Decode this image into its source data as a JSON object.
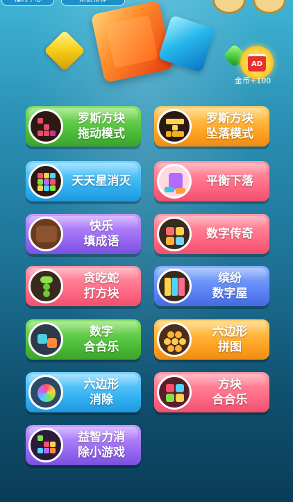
{
  "top": {
    "label_left": "福利中心",
    "label_middle": "新游推荐"
  },
  "ad": {
    "badge": "AD",
    "reward_text": "金币+100"
  },
  "games": [
    {
      "label": "罗斯方块\n拖动模式",
      "color": "green",
      "icon": "tetris-drag-icon"
    },
    {
      "label": "罗斯方块\n坠落模式",
      "color": "orange",
      "icon": "tetris-drop-icon"
    },
    {
      "label": "天天星消灭",
      "color": "blue",
      "icon": "star-crush-icon"
    },
    {
      "label": "平衡下落",
      "color": "pink",
      "icon": "balance-drop-icon"
    },
    {
      "label": "快乐\n填成语",
      "color": "purple",
      "icon": "idiom-puzzle-icon"
    },
    {
      "label": "数字传奇",
      "color": "pink",
      "icon": "number-legend-icon"
    },
    {
      "label": "贪吃蛇\n打方块",
      "color": "pink",
      "icon": "snake-blocks-icon"
    },
    {
      "label": "缤纷\n数字屋",
      "color": "indigo",
      "icon": "number-house-icon"
    },
    {
      "label": "数字\n合合乐",
      "color": "green",
      "icon": "number-merge-icon"
    },
    {
      "label": "六边形\n拼图",
      "color": "orange",
      "icon": "hexagon-puzzle-icon"
    },
    {
      "label": "六边形\n消除",
      "color": "blue",
      "icon": "hexagon-clear-icon"
    },
    {
      "label": "方块\n合合乐",
      "color": "pink",
      "icon": "block-merge-icon"
    },
    {
      "label": "益智力消\n除小游戏",
      "color": "purple",
      "icon": "brain-elimination-icon"
    }
  ]
}
